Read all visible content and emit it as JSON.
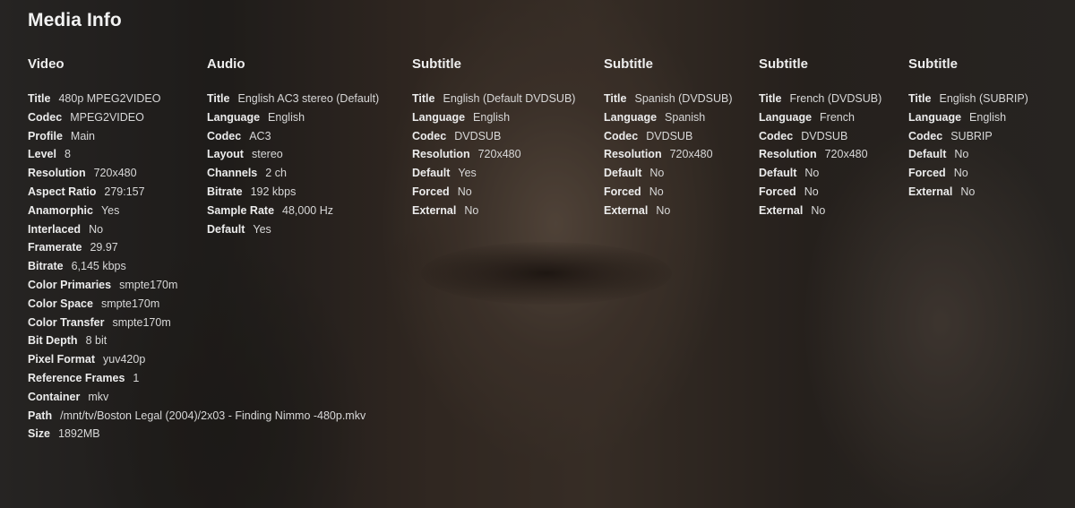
{
  "page": {
    "title": "Media Info"
  },
  "streams": [
    {
      "title": "Video",
      "rows": [
        {
          "label": "Title",
          "value": "480p MPEG2VIDEO"
        },
        {
          "label": "Codec",
          "value": "MPEG2VIDEO"
        },
        {
          "label": "Profile",
          "value": "Main"
        },
        {
          "label": "Level",
          "value": "8"
        },
        {
          "label": "Resolution",
          "value": "720x480"
        },
        {
          "label": "Aspect Ratio",
          "value": "279:157"
        },
        {
          "label": "Anamorphic",
          "value": "Yes"
        },
        {
          "label": "Interlaced",
          "value": "No"
        },
        {
          "label": "Framerate",
          "value": "29.97"
        },
        {
          "label": "Bitrate",
          "value": "6,145 kbps"
        },
        {
          "label": "Color Primaries",
          "value": "smpte170m"
        },
        {
          "label": "Color Space",
          "value": "smpte170m"
        },
        {
          "label": "Color Transfer",
          "value": "smpte170m"
        },
        {
          "label": "Bit Depth",
          "value": "8 bit"
        },
        {
          "label": "Pixel Format",
          "value": "yuv420p"
        },
        {
          "label": "Reference Frames",
          "value": "1"
        },
        {
          "label": "Container",
          "value": "mkv"
        },
        {
          "label": "Path",
          "value": "/mnt/tv/Boston Legal (2004)/2x03 - Finding Nimmo -480p.mkv"
        },
        {
          "label": "Size",
          "value": "1892MB"
        }
      ]
    },
    {
      "title": "Audio",
      "rows": [
        {
          "label": "Title",
          "value": "English AC3 stereo (Default)"
        },
        {
          "label": "Language",
          "value": "English"
        },
        {
          "label": "Codec",
          "value": "AC3"
        },
        {
          "label": "Layout",
          "value": "stereo"
        },
        {
          "label": "Channels",
          "value": "2 ch"
        },
        {
          "label": "Bitrate",
          "value": "192 kbps"
        },
        {
          "label": "Sample Rate",
          "value": "48,000 Hz"
        },
        {
          "label": "Default",
          "value": "Yes"
        }
      ]
    },
    {
      "title": "Subtitle",
      "rows": [
        {
          "label": "Title",
          "value": "English (Default DVDSUB)"
        },
        {
          "label": "Language",
          "value": "English"
        },
        {
          "label": "Codec",
          "value": "DVDSUB"
        },
        {
          "label": "Resolution",
          "value": "720x480"
        },
        {
          "label": "Default",
          "value": "Yes"
        },
        {
          "label": "Forced",
          "value": "No"
        },
        {
          "label": "External",
          "value": "No"
        }
      ]
    },
    {
      "title": "Subtitle",
      "rows": [
        {
          "label": "Title",
          "value": "Spanish (DVDSUB)"
        },
        {
          "label": "Language",
          "value": "Spanish"
        },
        {
          "label": "Codec",
          "value": "DVDSUB"
        },
        {
          "label": "Resolution",
          "value": "720x480"
        },
        {
          "label": "Default",
          "value": "No"
        },
        {
          "label": "Forced",
          "value": "No"
        },
        {
          "label": "External",
          "value": "No"
        }
      ]
    },
    {
      "title": "Subtitle",
      "rows": [
        {
          "label": "Title",
          "value": "French (DVDSUB)"
        },
        {
          "label": "Language",
          "value": "French"
        },
        {
          "label": "Codec",
          "value": "DVDSUB"
        },
        {
          "label": "Resolution",
          "value": "720x480"
        },
        {
          "label": "Default",
          "value": "No"
        },
        {
          "label": "Forced",
          "value": "No"
        },
        {
          "label": "External",
          "value": "No"
        }
      ]
    },
    {
      "title": "Subtitle",
      "rows": [
        {
          "label": "Title",
          "value": "English (SUBRIP)"
        },
        {
          "label": "Language",
          "value": "English"
        },
        {
          "label": "Codec",
          "value": "SUBRIP"
        },
        {
          "label": "Default",
          "value": "No"
        },
        {
          "label": "Forced",
          "value": "No"
        },
        {
          "label": "External",
          "value": "No"
        }
      ]
    }
  ]
}
